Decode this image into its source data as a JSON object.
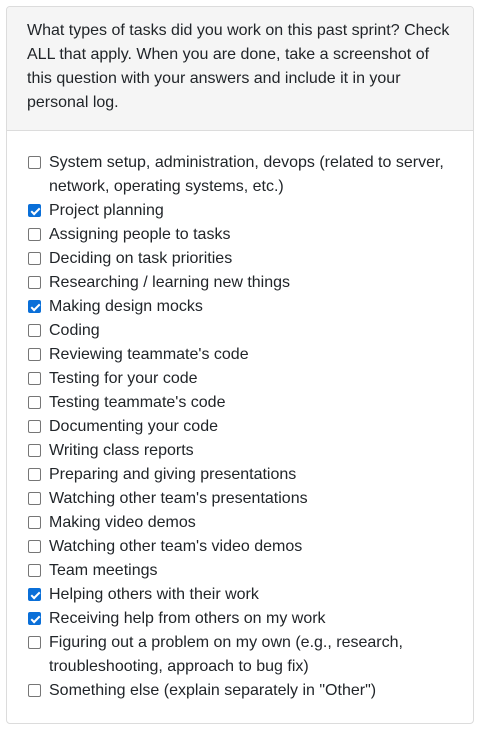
{
  "question": {
    "text": "What types of tasks did you work on this past sprint? Check ALL that apply. When you are done, take a screenshot of this question with your answers and include it in your personal log."
  },
  "options": [
    {
      "label": "System setup, administration, devops (related to server, network, operating systems, etc.)",
      "checked": false
    },
    {
      "label": "Project planning",
      "checked": true
    },
    {
      "label": "Assigning people to tasks",
      "checked": false
    },
    {
      "label": "Deciding on task priorities",
      "checked": false
    },
    {
      "label": "Researching / learning new things",
      "checked": false
    },
    {
      "label": "Making design mocks",
      "checked": true
    },
    {
      "label": "Coding",
      "checked": false
    },
    {
      "label": "Reviewing teammate's code",
      "checked": false
    },
    {
      "label": "Testing for your code",
      "checked": false
    },
    {
      "label": "Testing teammate's code",
      "checked": false
    },
    {
      "label": "Documenting your code",
      "checked": false
    },
    {
      "label": "Writing class reports",
      "checked": false
    },
    {
      "label": "Preparing and giving presentations",
      "checked": false
    },
    {
      "label": "Watching other team's presentations",
      "checked": false
    },
    {
      "label": "Making video demos",
      "checked": false
    },
    {
      "label": "Watching other team's video demos",
      "checked": false
    },
    {
      "label": "Team meetings",
      "checked": false
    },
    {
      "label": "Helping others with their work",
      "checked": true
    },
    {
      "label": "Receiving help from others on my work",
      "checked": true
    },
    {
      "label": "Figuring out a problem on my own (e.g., research, troubleshooting, approach to bug fix)",
      "checked": false
    },
    {
      "label": "Something else (explain separately in \"Other\")",
      "checked": false
    }
  ],
  "colors": {
    "checked": "#0a6fd8",
    "header_bg": "#f5f5f5",
    "border": "#dcdcdc"
  }
}
